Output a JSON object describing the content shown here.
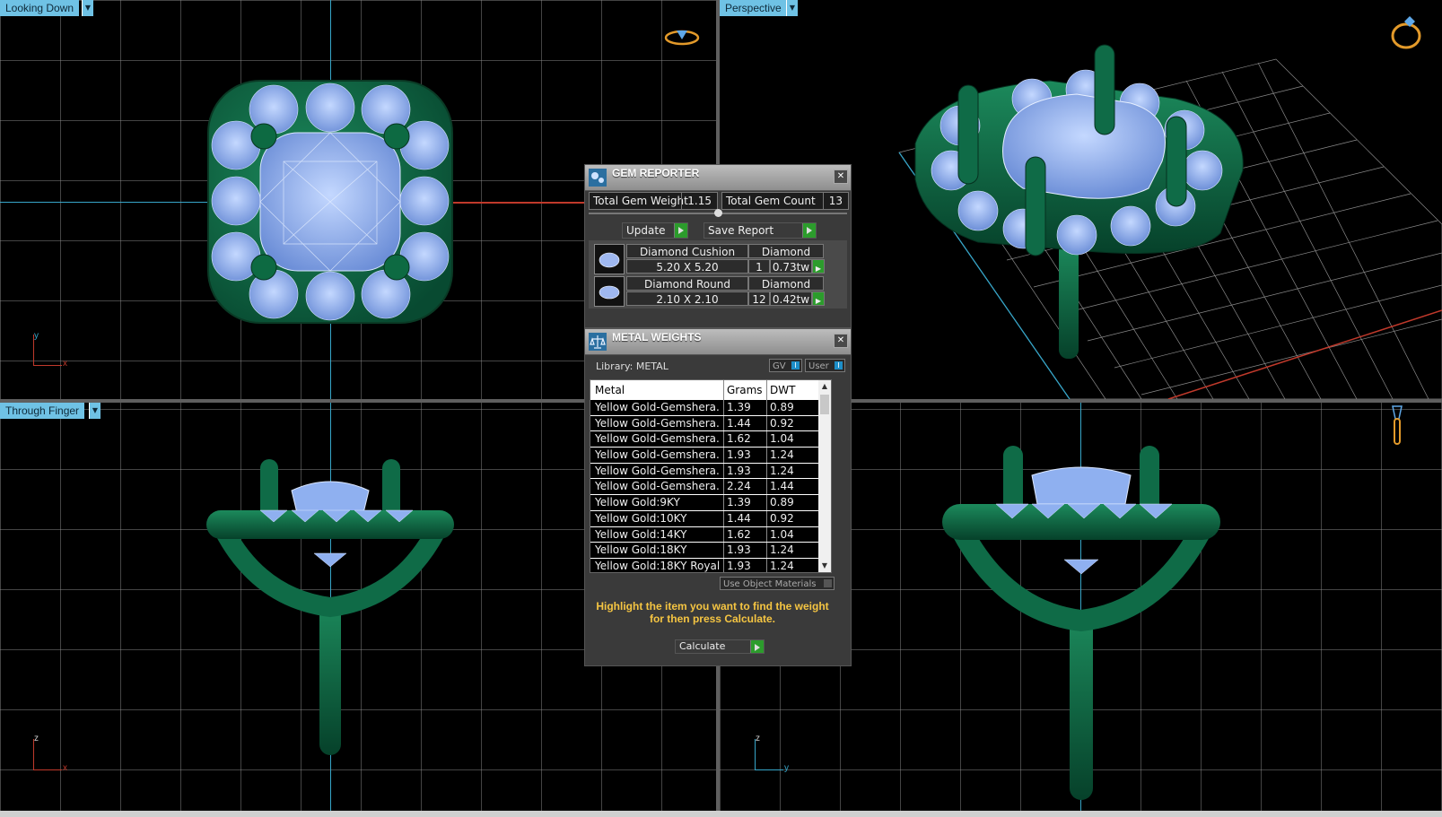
{
  "viewports": {
    "top_left": {
      "label": "Looking Down",
      "axes": [
        "y",
        "x"
      ]
    },
    "top_right": {
      "label": "Perspective"
    },
    "bottom_left": {
      "label": "Through Finger",
      "axes": [
        "z",
        "x"
      ]
    },
    "bottom_right": {
      "axes": [
        "z",
        "y"
      ]
    }
  },
  "gem_reporter": {
    "title": "GEM REPORTER",
    "total_weight_label": "Total Gem Weight",
    "total_weight_value": "1.15",
    "total_count_label": "Total Gem Count",
    "total_count_value": "13",
    "update_label": "Update",
    "save_label": "Save Report",
    "gems": [
      {
        "name": "Diamond Cushion",
        "material": "Diamond",
        "size": "5.20 X 5.20",
        "count": "1",
        "weight": "0.73tw"
      },
      {
        "name": "Diamond Round",
        "material": "Diamond",
        "size": "2.10 X 2.10",
        "count": "12",
        "weight": "0.42tw"
      }
    ]
  },
  "metal_weights": {
    "title": "METAL WEIGHTS",
    "library_label": "Library: METAL",
    "gv_label": "GV",
    "user_label": "User",
    "columns": [
      "Metal",
      "Grams",
      "DWT"
    ],
    "rows": [
      [
        "Yellow Gold-Gemshera...",
        "1.39",
        "0.89"
      ],
      [
        "Yellow Gold-Gemshera...",
        "1.44",
        "0.92"
      ],
      [
        "Yellow Gold-Gemshera...",
        "1.62",
        "1.04"
      ],
      [
        "Yellow Gold-Gemshera...",
        "1.93",
        "1.24"
      ],
      [
        "Yellow Gold-Gemshera...",
        "1.93",
        "1.24"
      ],
      [
        "Yellow Gold-Gemshera...",
        "2.24",
        "1.44"
      ],
      [
        "Yellow Gold:9KY",
        "1.39",
        "0.89"
      ],
      [
        "Yellow Gold:10KY",
        "1.44",
        "0.92"
      ],
      [
        "Yellow Gold:14KY",
        "1.62",
        "1.04"
      ],
      [
        "Yellow Gold:18KY",
        "1.93",
        "1.24"
      ],
      [
        "Yellow Gold:18KY Royal",
        "1.93",
        "1.24"
      ]
    ],
    "use_object_materials": "Use Object Materials",
    "hint": "Highlight the item you want to find the weight for then press Calculate.",
    "calculate_label": "Calculate"
  },
  "colors": {
    "metal": "#0f6b47",
    "gem": "#8fb0f0",
    "label_bg": "#6fc2e5",
    "hint": "#f5c542"
  }
}
